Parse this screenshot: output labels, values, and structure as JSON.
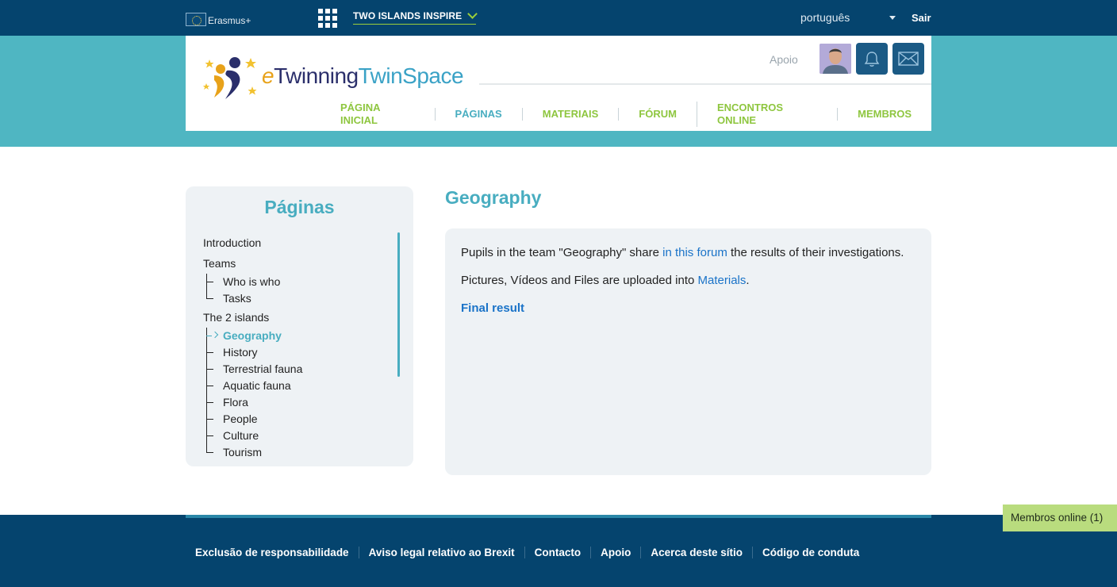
{
  "topbar": {
    "erasmus_label": "Erasmus+",
    "project_name": "TWO ISLANDS INSPIRE",
    "language": "português",
    "logout": "Sair"
  },
  "header": {
    "logo_text_e": "e",
    "logo_text_main": "Twinning",
    "logo_text_space": "TwinSpace",
    "apoio": "Apoio",
    "nav": [
      "PÁGINA INICIAL",
      "PÁGINAS",
      "MATERIAIS",
      "FÓRUM",
      "ENCONTROS ONLINE",
      "MEMBROS"
    ],
    "active_nav": "PÁGINAS"
  },
  "sidebar": {
    "title": "Páginas",
    "items": [
      {
        "label": "Introduction",
        "level": 0
      },
      {
        "label": "Teams",
        "level": 0
      },
      {
        "label": "Who is who",
        "level": 1
      },
      {
        "label": "Tasks",
        "level": 1
      },
      {
        "label": "The 2 islands",
        "level": 0
      },
      {
        "label": "Geography",
        "level": 1,
        "active": true
      },
      {
        "label": "History",
        "level": 1
      },
      {
        "label": "Terrestrial fauna",
        "level": 1
      },
      {
        "label": "Aquatic fauna",
        "level": 1
      },
      {
        "label": "Flora",
        "level": 1
      },
      {
        "label": "People",
        "level": 1
      },
      {
        "label": "Culture",
        "level": 1
      },
      {
        "label": "Tourism",
        "level": 1
      }
    ]
  },
  "main": {
    "title": "Geography",
    "p1_before": "Pupils in the team \"Geography\" share ",
    "p1_link": "in this forum",
    "p1_after": " the results of their investigations.",
    "p2_before": "Pictures, Vídeos and Files are uploaded into ",
    "p2_link": "Materials",
    "p2_after": ".",
    "final_link": "Final result"
  },
  "footer": {
    "links": [
      "Exclusão de responsabilidade",
      "Aviso legal relativo ao Brexit",
      "Contacto",
      "Apoio",
      "Acerca deste sítio",
      "Código de conduta"
    ]
  },
  "online": {
    "label": "Membros online (1)"
  },
  "colors": {
    "topbar": "#05446e",
    "band": "#4fb6c2",
    "accent_teal": "#48adc0",
    "nav_green": "#8ec63f",
    "link_blue": "#1a73c8",
    "online_green": "#b9dc7e"
  }
}
